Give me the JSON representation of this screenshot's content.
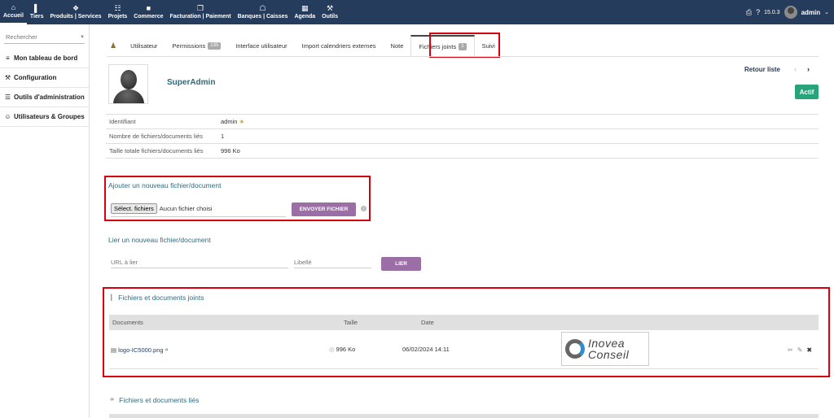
{
  "topnav": [
    {
      "icon": "⌂",
      "icon_name": "home-icon",
      "label": "Accueil",
      "active": true
    },
    {
      "icon": "▌",
      "icon_name": "building-icon",
      "label": "Tiers"
    },
    {
      "icon": "❖",
      "icon_name": "cube-icon",
      "label": "Produits | Services"
    },
    {
      "icon": "☷",
      "icon_name": "project-icon",
      "label": "Projets"
    },
    {
      "icon": "■",
      "icon_name": "briefcase-icon",
      "label": "Commerce"
    },
    {
      "icon": "❐",
      "icon_name": "invoice-icon",
      "label": "Facturation | Paiement"
    },
    {
      "icon": "☖",
      "icon_name": "bank-icon",
      "label": "Banques | Caisses"
    },
    {
      "icon": "▦",
      "icon_name": "calendar-icon",
      "label": "Agenda"
    },
    {
      "icon": "⚒",
      "icon_name": "wrench-icon",
      "label": "Outils"
    }
  ],
  "topright": {
    "print_icon": "⎙",
    "help_icon": "?",
    "version": "15.0.3",
    "user": "admin",
    "dropdown_icon": "⌄"
  },
  "sidebar": {
    "search_placeholder": "Rechercher",
    "items": [
      {
        "icon": "≡",
        "icon_name": "dashboard-icon",
        "label": "Mon tableau de bord"
      },
      {
        "icon": "⚒",
        "icon_name": "tools-icon",
        "label": "Configuration"
      },
      {
        "icon": "☰",
        "icon_name": "admin-icon",
        "label": "Outils d'administration"
      },
      {
        "icon": "☺",
        "icon_name": "users-icon",
        "label": "Utilisateurs & Groupes"
      }
    ]
  },
  "tabs": [
    {
      "label": "Utilisateur"
    },
    {
      "label": "Permissions",
      "badge": "135"
    },
    {
      "label": "Interface utilisateur"
    },
    {
      "label": "Import calendriers externes"
    },
    {
      "label": "Note"
    },
    {
      "label": "Fichiers joints",
      "badge": "1",
      "active": true
    },
    {
      "label": "Suivi"
    }
  ],
  "header": {
    "username": "SuperAdmin",
    "back_list": "Retour liste",
    "prev_icon": "‹",
    "next_icon": "›",
    "status": "Actif",
    "status_color": "#27a47a"
  },
  "info": [
    {
      "label": "Identifiant",
      "value": "admin"
    },
    {
      "label": "Nombre de fichiers/documents liés",
      "value": "1"
    },
    {
      "label": "Taille totale fichiers/documents liés",
      "value": "996 Ko"
    }
  ],
  "star_icon": "★",
  "upload": {
    "title": "Ajouter un nouveau fichier/document",
    "choose_label": "Sélect. fichiers",
    "no_file": "Aucun fichier choisi",
    "send_label": "ENVOYER FICHIER",
    "info_icon": "i"
  },
  "link": {
    "title": "Lier un nouveau fichier/document",
    "url_placeholder": "URL à lier",
    "label_placeholder": "Libellé",
    "button": "LIER"
  },
  "docs": {
    "title_icon": "❙",
    "title": "Fichiers et documents joints",
    "columns": [
      "Documents",
      "Taille",
      "Date"
    ],
    "rows": [
      {
        "file_icon": "▤",
        "name": "logo-IC5000.png",
        "zoom_icon": "⌕",
        "size_icon": "◎",
        "size": "996 Ko",
        "date": "06/02/2024 14:11",
        "preview_line1": "Inovea",
        "preview_line2": "Conseil"
      }
    ],
    "action_icons": [
      "✂",
      "✎",
      "✖"
    ]
  },
  "linked": {
    "icon": "⚭",
    "title": "Fichiers et documents liés"
  },
  "colors": {
    "topbar": "#263c5c",
    "accent_teal": "#2c6b7d",
    "button_purple": "#9b6fa6",
    "highlight_red": "#d9000d"
  }
}
